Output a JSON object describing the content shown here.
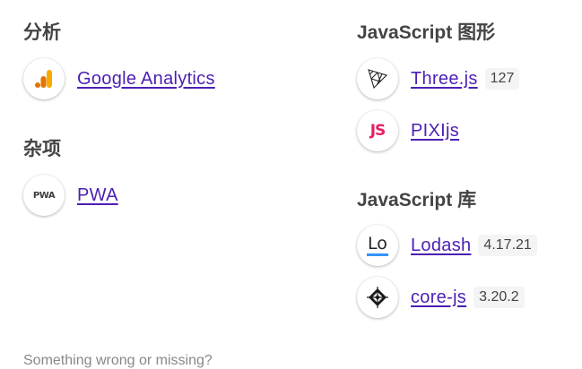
{
  "left_column": {
    "analytics": {
      "title": "分析",
      "items": [
        {
          "icon": "google-analytics-icon",
          "name": "Google Analytics"
        }
      ]
    },
    "misc": {
      "title": "杂项",
      "items": [
        {
          "icon": "pwa-icon",
          "name": "PWA",
          "logo_text": "PWA"
        }
      ]
    }
  },
  "right_column": {
    "graphics": {
      "title": "JavaScript 图形",
      "items": [
        {
          "icon": "threejs-icon",
          "name": "Three.js",
          "version": "127"
        },
        {
          "icon": "pixijs-icon",
          "name": "PIXIjs",
          "logo_text": "JS"
        }
      ]
    },
    "libraries": {
      "title": "JavaScript 库",
      "items": [
        {
          "icon": "lodash-icon",
          "name": "Lodash",
          "version": "4.17.21",
          "logo_text": "Lo"
        },
        {
          "icon": "core-js-icon",
          "name": "core-js",
          "version": "3.20.2"
        }
      ]
    }
  },
  "footer": {
    "text": "Something wrong or missing?"
  },
  "colors": {
    "link": "#4b1fb3",
    "heading": "#444444",
    "analytics_orange": "#f9ab00",
    "analytics_dark_orange": "#e37400",
    "pixi_pink": "#e91e63",
    "lodash_blue": "#3492ff"
  }
}
